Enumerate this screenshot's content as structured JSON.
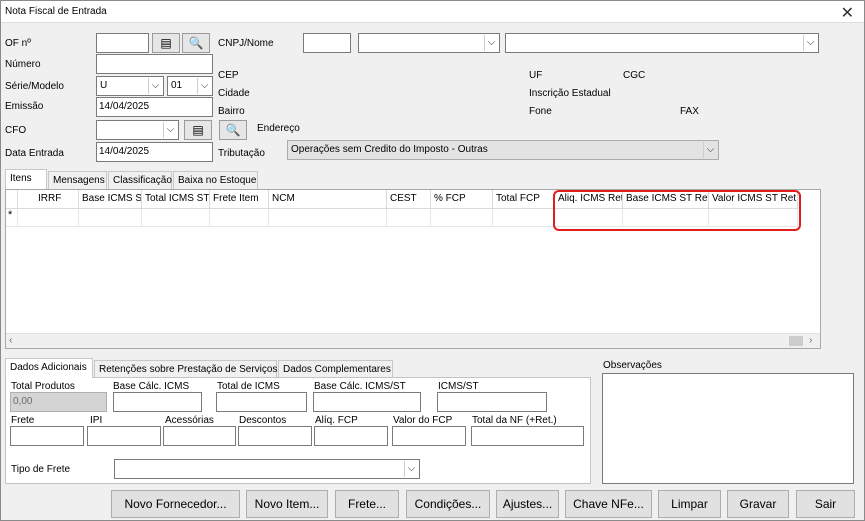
{
  "window": {
    "title": "Nota Fiscal de Entrada"
  },
  "header": {
    "of_label": "OF nº",
    "of_value": "",
    "numero_label": "Número",
    "numero_value": "",
    "serie_label": "Série/Modelo",
    "serie_value": "U",
    "modelo_value": "01",
    "emissao_label": "Emissão",
    "emissao_value": "14/04/2025",
    "cfo_label": "CFO",
    "cfo_value": "",
    "data_entrada_label": "Data Entrada",
    "data_entrada_value": "14/04/2025",
    "cnpj_label": "CNPJ/Nome",
    "cnpj_value": "",
    "cep_label": "CEP",
    "cidade_label": "Cidade",
    "bairro_label": "Bairro",
    "endereco_label": "Endereço",
    "tributacao_label": "Tributação",
    "tributacao_value": "Operações sem Credito do Imposto - Outras",
    "uf_label": "UF",
    "cgc_label": "CGC",
    "ie_label": "Inscrição Estadual",
    "fone_label": "Fone",
    "fax_label": "FAX"
  },
  "tabs": [
    "Itens",
    "Mensagens",
    "Classificação",
    "Baixa no Estoque"
  ],
  "grid": {
    "columns": [
      "IRRF",
      "Base ICMS ST",
      "Total ICMS ST",
      "Frete Item",
      "NCM",
      "CEST",
      "% FCP",
      "Total FCP",
      "Aliq. ICMS Ret",
      "Base ICMS ST Ret",
      "Valor ICMS ST Ret"
    ],
    "new_row_marker": "*",
    "highlight_color": "#e21d1d"
  },
  "bottom_tabs": [
    "Dados Adicionais",
    "Retenções sobre Prestação de Serviços",
    "Dados Complementares"
  ],
  "totals": {
    "total_produtos_label": "Total Produtos",
    "total_produtos_value": "0,00",
    "base_icms_label": "Base Cálc. ICMS",
    "total_icms_label": "Total de ICMS",
    "base_icms_st_label": "Base Cálc. ICMS/ST",
    "icms_st_label": "ICMS/ST",
    "frete_label": "Frete",
    "ipi_label": "IPI",
    "acessorias_label": "Acessórias",
    "descontos_label": "Descontos",
    "aliq_fcp_label": "Alíq. FCP",
    "valor_fcp_label": "Valor do FCP",
    "total_nf_label": "Total da NF (+Ret.)",
    "tipo_frete_label": "Tipo de Frete"
  },
  "observacoes_label": "Observações",
  "buttons": [
    "Novo Fornecedor...",
    "Novo Item...",
    "Frete...",
    "Condições...",
    "Ajustes...",
    "Chave NFe...",
    "Limpar",
    "Gravar",
    "Sair"
  ]
}
